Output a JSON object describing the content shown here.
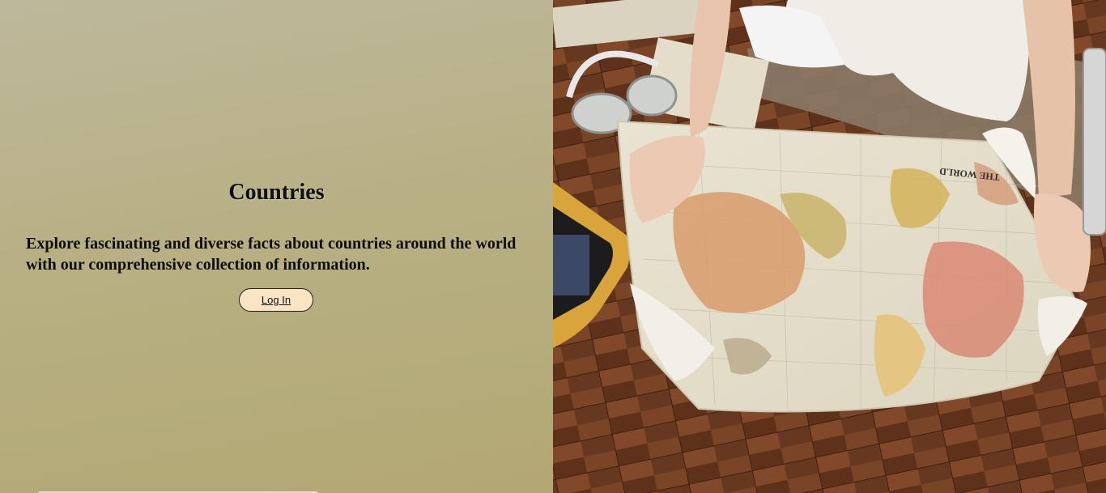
{
  "hero": {
    "title": "Countries",
    "description": "Explore fascinating and diverse facts about countries around the world with our comprehensive collection of information.",
    "login_label": "Log In"
  },
  "photo": {
    "subject": "world-map-travel-photo",
    "map_caption": "THE WORLD"
  },
  "colors": {
    "panel_start": "#bdb89c",
    "panel_end": "#b3a874",
    "button_bg": "#fbe4c4",
    "text": "#0c0c0c"
  }
}
